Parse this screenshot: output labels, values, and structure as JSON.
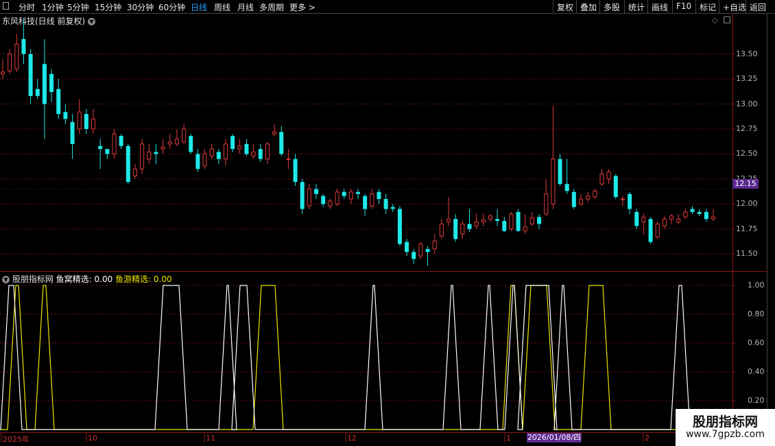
{
  "toolbar": {
    "periods": [
      "分时",
      "1分钟",
      "5分钟",
      "15分钟",
      "30分钟",
      "60分钟",
      "日线",
      "周线",
      "月线",
      "多周期",
      "更多 >"
    ],
    "active": "日线",
    "right_buttons": [
      "复权",
      "叠加",
      "多股",
      "统计",
      "画线",
      "F10",
      "标记",
      "+自选",
      "返回"
    ]
  },
  "main_chart": {
    "title": "东风科技(日线 前复权)",
    "y_ticks": [
      "13.50",
      "13.25",
      "13.00",
      "12.75",
      "12.50",
      "12.25",
      "12.00",
      "11.75",
      "11.50"
    ],
    "current_price": "12.15",
    "colors": {
      "up": "#e23b3b",
      "down": "#1ee8e8",
      "grid": "#6b1414"
    }
  },
  "indicator": {
    "name": "股朋指标网",
    "line1_label": "鱼窝精选: 0.00",
    "line2_label": "鱼游精选: 0.00",
    "y_ticks": [
      "1.00",
      "0.80",
      "0.60",
      "0.40",
      "0.20"
    ],
    "colors": {
      "line1": "#ffffff",
      "line2": "#f0e500"
    }
  },
  "x_axis": {
    "labels": [
      "2025年",
      "10",
      "11",
      "12",
      "1",
      "2"
    ],
    "cursor_date": "2026/01/08/四"
  },
  "watermark": {
    "name": "股朋指标网",
    "url": "www.7gpzb.com"
  },
  "chart_data": {
    "type": "candlestick",
    "y_range": [
      11.35,
      13.8
    ],
    "candles": [
      [
        13.3,
        13.32,
        13.45,
        13.25
      ],
      [
        13.33,
        13.5,
        13.55,
        13.3
      ],
      [
        13.35,
        13.6,
        13.7,
        13.32
      ],
      [
        13.65,
        13.5,
        13.85,
        13.4
      ],
      [
        13.5,
        13.08,
        13.55,
        13.0
      ],
      [
        13.15,
        13.08,
        13.25,
        13.05
      ],
      [
        13.4,
        13.0,
        13.65,
        12.65
      ],
      [
        13.3,
        13.12,
        13.35,
        13.02
      ],
      [
        13.15,
        12.9,
        13.25,
        12.85
      ],
      [
        12.92,
        12.85,
        13.0,
        12.8
      ],
      [
        12.82,
        12.6,
        12.9,
        12.45
      ],
      [
        12.75,
        12.92,
        13.05,
        12.7
      ],
      [
        12.9,
        12.75,
        12.95,
        12.7
      ],
      [
        12.75,
        12.85,
        12.95,
        12.7
      ],
      [
        12.58,
        12.55,
        12.65,
        12.35
      ],
      [
        12.55,
        12.5,
        12.55,
        12.45
      ],
      [
        12.5,
        12.7,
        12.75,
        12.45
      ],
      [
        12.68,
        12.58,
        12.7,
        12.55
      ],
      [
        12.58,
        12.22,
        12.6,
        12.2
      ],
      [
        12.28,
        12.35,
        12.4,
        12.25
      ],
      [
        12.35,
        12.6,
        12.65,
        12.3
      ],
      [
        12.45,
        12.52,
        12.6,
        12.4
      ],
      [
        12.52,
        12.5,
        12.6,
        12.4
      ],
      [
        12.55,
        12.57,
        12.65,
        12.5
      ],
      [
        12.6,
        12.62,
        12.7,
        12.55
      ],
      [
        12.6,
        12.65,
        12.75,
        12.58
      ],
      [
        12.62,
        12.75,
        12.8,
        12.6
      ],
      [
        12.68,
        12.52,
        12.7,
        12.5
      ],
      [
        12.5,
        12.35,
        12.55,
        12.32
      ],
      [
        12.38,
        12.5,
        12.55,
        12.35
      ],
      [
        12.48,
        12.55,
        12.6,
        12.45
      ],
      [
        12.52,
        12.45,
        12.55,
        12.4
      ],
      [
        12.45,
        12.6,
        12.65,
        12.38
      ],
      [
        12.68,
        12.55,
        12.7,
        12.52
      ],
      [
        12.55,
        12.58,
        12.65,
        12.5
      ],
      [
        12.6,
        12.5,
        12.65,
        12.48
      ],
      [
        12.48,
        12.52,
        12.6,
        12.45
      ],
      [
        12.55,
        12.45,
        12.6,
        12.42
      ],
      [
        12.45,
        12.6,
        12.62,
        12.4
      ],
      [
        12.7,
        12.72,
        12.8,
        12.68
      ],
      [
        12.72,
        12.5,
        12.78,
        12.48
      ],
      [
        12.45,
        12.45,
        12.55,
        12.35
      ],
      [
        12.45,
        12.22,
        12.5,
        12.18
      ],
      [
        12.22,
        11.95,
        12.25,
        11.9
      ],
      [
        11.98,
        12.15,
        12.2,
        11.95
      ],
      [
        12.15,
        12.1,
        12.2,
        12.05
      ],
      [
        12.08,
        12.0,
        12.1,
        11.97
      ],
      [
        11.98,
        12.03,
        12.05,
        11.95
      ],
      [
        12.0,
        12.12,
        12.15,
        11.98
      ],
      [
        12.12,
        12.08,
        12.15,
        12.05
      ],
      [
        12.05,
        12.12,
        12.15,
        12.0
      ],
      [
        12.12,
        12.1,
        12.15,
        12.05
      ],
      [
        12.08,
        11.95,
        12.1,
        11.88
      ],
      [
        11.98,
        12.1,
        12.15,
        11.95
      ],
      [
        12.12,
        12.05,
        12.15,
        12.0
      ],
      [
        12.05,
        11.95,
        12.1,
        11.9
      ],
      [
        11.97,
        11.95,
        12.0,
        11.92
      ],
      [
        11.95,
        11.6,
        11.98,
        11.58
      ],
      [
        11.62,
        11.52,
        11.65,
        11.48
      ],
      [
        11.52,
        11.45,
        11.55,
        11.4
      ],
      [
        11.48,
        11.6,
        11.62,
        11.45
      ],
      [
        11.55,
        11.52,
        11.58,
        11.38
      ],
      [
        11.55,
        11.63,
        11.7,
        11.5
      ],
      [
        11.68,
        11.8,
        11.85,
        11.65
      ],
      [
        11.82,
        11.85,
        12.07,
        11.78
      ],
      [
        11.85,
        11.65,
        11.9,
        11.62
      ],
      [
        11.7,
        11.8,
        11.83,
        11.65
      ],
      [
        11.8,
        11.75,
        11.95,
        11.72
      ],
      [
        11.78,
        11.82,
        11.9,
        11.75
      ],
      [
        11.82,
        11.84,
        11.9,
        11.78
      ],
      [
        11.85,
        11.88,
        11.9,
        11.82
      ],
      [
        11.85,
        11.83,
        11.95,
        11.78
      ],
      [
        11.83,
        11.73,
        11.87,
        11.72
      ],
      [
        11.75,
        11.9,
        11.92,
        11.73
      ],
      [
        11.92,
        11.73,
        11.95,
        11.72
      ],
      [
        11.73,
        11.77,
        11.9,
        11.7
      ],
      [
        11.8,
        11.86,
        11.92,
        11.78
      ],
      [
        11.87,
        11.8,
        11.9,
        11.75
      ],
      [
        11.9,
        12.1,
        12.25,
        11.88
      ],
      [
        12.0,
        12.45,
        12.98,
        11.95
      ],
      [
        12.45,
        12.2,
        12.5,
        12.18
      ],
      [
        12.2,
        12.13,
        12.45,
        12.1
      ],
      [
        12.12,
        11.97,
        12.15,
        11.95
      ],
      [
        12.0,
        12.05,
        12.1,
        11.98
      ],
      [
        12.05,
        12.08,
        12.12,
        12.02
      ],
      [
        12.07,
        12.13,
        12.15,
        12.05
      ],
      [
        12.2,
        12.3,
        12.35,
        12.18
      ],
      [
        12.25,
        12.32,
        12.35,
        12.2
      ],
      [
        12.28,
        12.07,
        12.3,
        12.05
      ],
      [
        12.05,
        12.05,
        12.08,
        11.98
      ],
      [
        12.1,
        11.95,
        12.12,
        11.9
      ],
      [
        11.92,
        11.78,
        11.95,
        11.75
      ],
      [
        11.82,
        11.87,
        11.9,
        11.7
      ],
      [
        11.85,
        11.62,
        11.87,
        11.6
      ],
      [
        11.67,
        11.8,
        11.82,
        11.65
      ],
      [
        11.78,
        11.85,
        11.88,
        11.75
      ],
      [
        11.85,
        11.88,
        11.9,
        11.8
      ],
      [
        11.82,
        11.85,
        11.9,
        11.8
      ],
      [
        11.87,
        11.92,
        11.95,
        11.85
      ],
      [
        11.95,
        11.92,
        11.98,
        11.9
      ],
      [
        11.92,
        11.9,
        11.95,
        11.88
      ],
      [
        11.92,
        11.85,
        11.95,
        11.82
      ],
      [
        11.85,
        11.87,
        11.95,
        11.83
      ]
    ],
    "indicator_series": [
      {
        "name": "鱼窝精选",
        "on_ranges": [
          [
            13,
            20
          ],
          [
            238,
            261
          ],
          [
            331,
            333
          ],
          [
            350,
            360
          ],
          [
            544,
            546
          ],
          [
            658,
            660
          ],
          [
            712,
            714
          ],
          [
            748,
            750
          ],
          [
            767,
            800
          ],
          [
            820,
            822
          ],
          [
            990,
            994
          ]
        ]
      },
      {
        "name": "鱼游精选",
        "on_ranges": [
          [
            23,
            27
          ],
          [
            63,
            67
          ],
          [
            381,
            401
          ],
          [
            745,
            750
          ],
          [
            774,
            797
          ],
          [
            859,
            879
          ]
        ]
      }
    ]
  }
}
